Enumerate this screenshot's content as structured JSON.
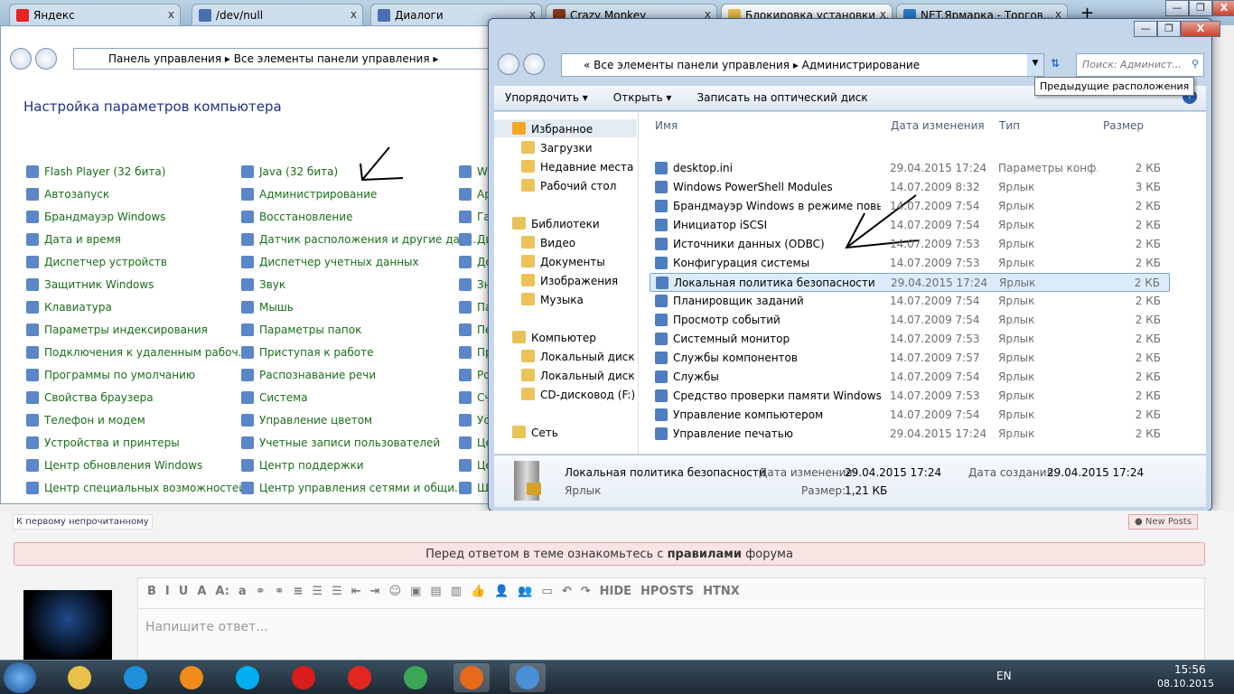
{
  "browser": {
    "tabs": [
      {
        "label": "Яндекс",
        "color": "#e52620"
      },
      {
        "label": "/dev/null",
        "color": "#4a6fb0"
      },
      {
        "label": "Диалоги",
        "color": "#4a6fb0"
      },
      {
        "label": "Crazy Monkey",
        "color": "#8b3a1a"
      },
      {
        "label": "Блокировка установки ...",
        "color": "#e8c14a",
        "active": true
      },
      {
        "label": "NET.Ярмарка - Торгов...",
        "color": "#2a7fd0"
      }
    ],
    "new_tab": "+",
    "close": "x"
  },
  "control_panel": {
    "breadcrumb": [
      "Панель управления",
      "Все элементы панели управления"
    ],
    "title": "Настройка параметров компьютера",
    "col1": [
      "Flash Player (32 бита)",
      "Автозапуск",
      "Брандмауэр Windows",
      "Дата и время",
      "Диспетчер устройств",
      "Защитник Windows",
      "Клавиатура",
      "Параметры индексирования",
      "Подключения к удаленным рабоч...",
      "Программы по умолчанию",
      "Свойства браузера",
      "Телефон и модем",
      "Устройства и принтеры",
      "Центр обновления Windows",
      "Центр специальных возможностей"
    ],
    "col2": [
      "Java (32 бита)",
      "Администрирование",
      "Восстановление",
      "Датчик расположения и другие дат...",
      "Диспетчер учетных данных",
      "Звук",
      "Мышь",
      "Параметры папок",
      "Приступая к работе",
      "Распознавание речи",
      "Система",
      "Управление цветом",
      "Учетные записи пользователей",
      "Центр поддержки",
      "Центр управления сетями и общи..."
    ],
    "col3": [
      "Wi",
      "Ар",
      "Га",
      "Ди",
      "До",
      "Зн",
      "Па",
      "Пе",
      "Пр",
      "Ро",
      "Сч",
      "Ус",
      "Це",
      "Це",
      "Шр"
    ]
  },
  "explorer": {
    "breadcrumb_prefix": "«",
    "breadcrumb": [
      "Все элементы панели управления",
      "Администрирование"
    ],
    "search_placeholder": "Поиск: Админист...",
    "tooltip": "Предыдущие расположения",
    "toolbar": [
      "Упорядочить ▾",
      "Открыть ▾",
      "Записать на оптический диск"
    ],
    "nav": [
      {
        "label": "Избранное",
        "level": 0
      },
      {
        "label": "Загрузки",
        "level": 1
      },
      {
        "label": "Недавние места",
        "level": 1
      },
      {
        "label": "Рабочий стол",
        "level": 1
      },
      {
        "label": "Библиотеки",
        "level": 0,
        "gap": true
      },
      {
        "label": "Видео",
        "level": 1
      },
      {
        "label": "Документы",
        "level": 1
      },
      {
        "label": "Изображения",
        "level": 1
      },
      {
        "label": "Музыка",
        "level": 1
      },
      {
        "label": "Компьютер",
        "level": 0,
        "gap": true
      },
      {
        "label": "Локальный диск (C",
        "level": 1
      },
      {
        "label": "Локальный диск (D",
        "level": 1
      },
      {
        "label": "CD-дисковод (F:)",
        "level": 1
      },
      {
        "label": "Сеть",
        "level": 0,
        "gap": true
      }
    ],
    "columns": [
      "Имя",
      "Дата изменения",
      "Тип",
      "Размер"
    ],
    "files": [
      [
        "desktop.ini",
        "29.04.2015 17:24",
        "Параметры конф...",
        "2 КБ"
      ],
      [
        "Windows PowerShell Modules",
        "14.07.2009 8:32",
        "Ярлык",
        "3 КБ"
      ],
      [
        "Брандмауэр Windows в режиме повы...",
        "14.07.2009 7:54",
        "Ярлык",
        "2 КБ"
      ],
      [
        "Инициатор iSCSI",
        "14.07.2009 7:54",
        "Ярлык",
        "2 КБ"
      ],
      [
        "Источники данных (ODBC)",
        "14.07.2009 7:53",
        "Ярлык",
        "2 КБ"
      ],
      [
        "Конфигурация системы",
        "14.07.2009 7:53",
        "Ярлык",
        "2 КБ"
      ],
      [
        "Локальная политика безопасности",
        "29.04.2015 17:24",
        "Ярлык",
        "2 КБ"
      ],
      [
        "Планировщик заданий",
        "14.07.2009 7:54",
        "Ярлык",
        "2 КБ"
      ],
      [
        "Просмотр событий",
        "14.07.2009 7:54",
        "Ярлык",
        "2 КБ"
      ],
      [
        "Системный монитор",
        "14.07.2009 7:53",
        "Ярлык",
        "2 КБ"
      ],
      [
        "Службы компонентов",
        "14.07.2009 7:57",
        "Ярлык",
        "2 КБ"
      ],
      [
        "Службы",
        "14.07.2009 7:54",
        "Ярлык",
        "2 КБ"
      ],
      [
        "Средство проверки памяти Windows",
        "14.07.2009 7:53",
        "Ярлык",
        "2 КБ"
      ],
      [
        "Управление компьютером",
        "14.07.2009 7:54",
        "Ярлык",
        "2 КБ"
      ],
      [
        "Управление печатью",
        "29.04.2015 17:24",
        "Ярлык",
        "2 КБ"
      ]
    ],
    "selected_index": 6,
    "details": {
      "name": "Локальная политика безопасности",
      "type": "Ярлык",
      "modified_label": "Дата изменения:",
      "modified": "29.04.2015 17:24",
      "created_label": "Дата создания:",
      "created": "29.04.2015 17:24",
      "size_label": "Размер:",
      "size": "1,21 КБ"
    }
  },
  "forum": {
    "first_unread": "К первому непрочитанному",
    "new_posts": "New Posts",
    "notice_pre": "Перед ответом в теме ознакомьтесь с ",
    "notice_bold": "правилами",
    "notice_post": " форума",
    "toolbar": [
      "B",
      "I",
      "U",
      "A",
      "A:",
      "a",
      "⚭",
      "⚭",
      "≡",
      "☰",
      "☰",
      "⇤",
      "⇥",
      "☺",
      "▣",
      "▤",
      "▥",
      "👍",
      "👤",
      "👥",
      "▭",
      "↶",
      "↷",
      "HIDE",
      "HPOSTS",
      "HTNX"
    ],
    "placeholder": "Напишите ответ..."
  },
  "taskbar": {
    "lang": "EN",
    "time": "15:56",
    "date": "08.10.2015",
    "apps": [
      {
        "name": "explorer",
        "color": "#e8c14a"
      },
      {
        "name": "ie",
        "color": "#1e8fd8"
      },
      {
        "name": "media",
        "color": "#f08a1a"
      },
      {
        "name": "skype",
        "color": "#00aff0"
      },
      {
        "name": "opera",
        "color": "#d91c1c"
      },
      {
        "name": "yandex",
        "color": "#e52620"
      },
      {
        "name": "chrome",
        "color": "#3aa757"
      },
      {
        "name": "firefox",
        "color": "#e66a1a"
      },
      {
        "name": "control-panel",
        "color": "#4a8fd8"
      }
    ]
  }
}
